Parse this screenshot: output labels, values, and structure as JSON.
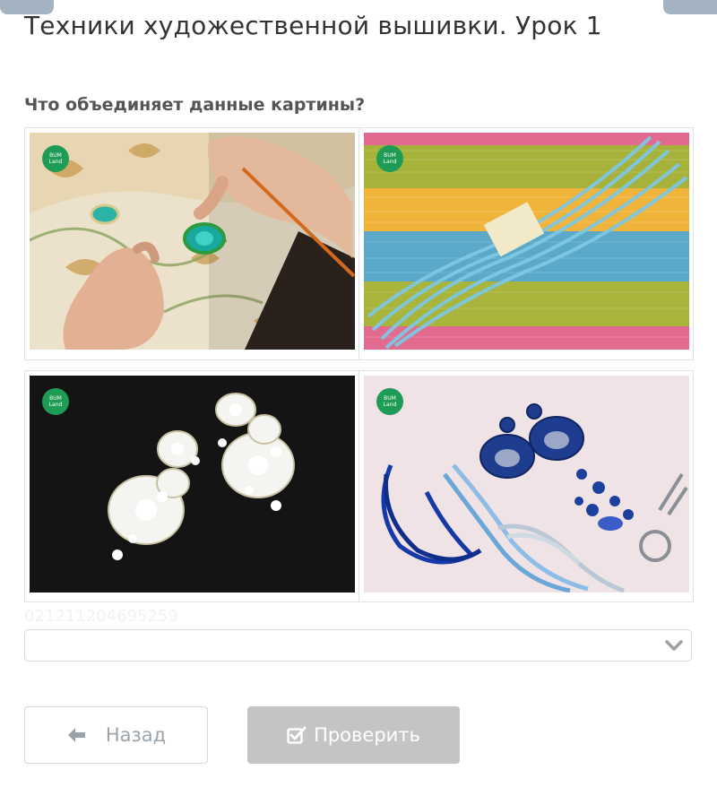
{
  "header": {
    "title": "Техники художественной вышивки. Урок 1"
  },
  "question": {
    "text": "Что объединяет данные картины?"
  },
  "images": [
    {
      "id": "photo-embroidery-hands",
      "logo_line1": "BUM",
      "logo_line2": "Land"
    },
    {
      "id": "photo-colored-cords",
      "logo_line1": "BUM",
      "logo_line2": "Land"
    },
    {
      "id": "photo-white-earrings",
      "logo_line1": "BUM",
      "logo_line2": "Land"
    },
    {
      "id": "photo-blue-earrings-supplies",
      "logo_line1": "BUM",
      "logo_line2": "Land"
    }
  ],
  "faint_code": "021211204695259",
  "answer_select": {
    "value": ""
  },
  "buttons": {
    "back_label": "Назад",
    "check_label": "Проверить"
  },
  "icons": {
    "back": "arrow-left-icon",
    "check": "checkbox-icon",
    "select": "chevron-down-icon"
  },
  "colors": {
    "logo": "#1e9b55",
    "check_button_bg": "#c4c4c4",
    "back_button_text": "#9aa3aa"
  }
}
